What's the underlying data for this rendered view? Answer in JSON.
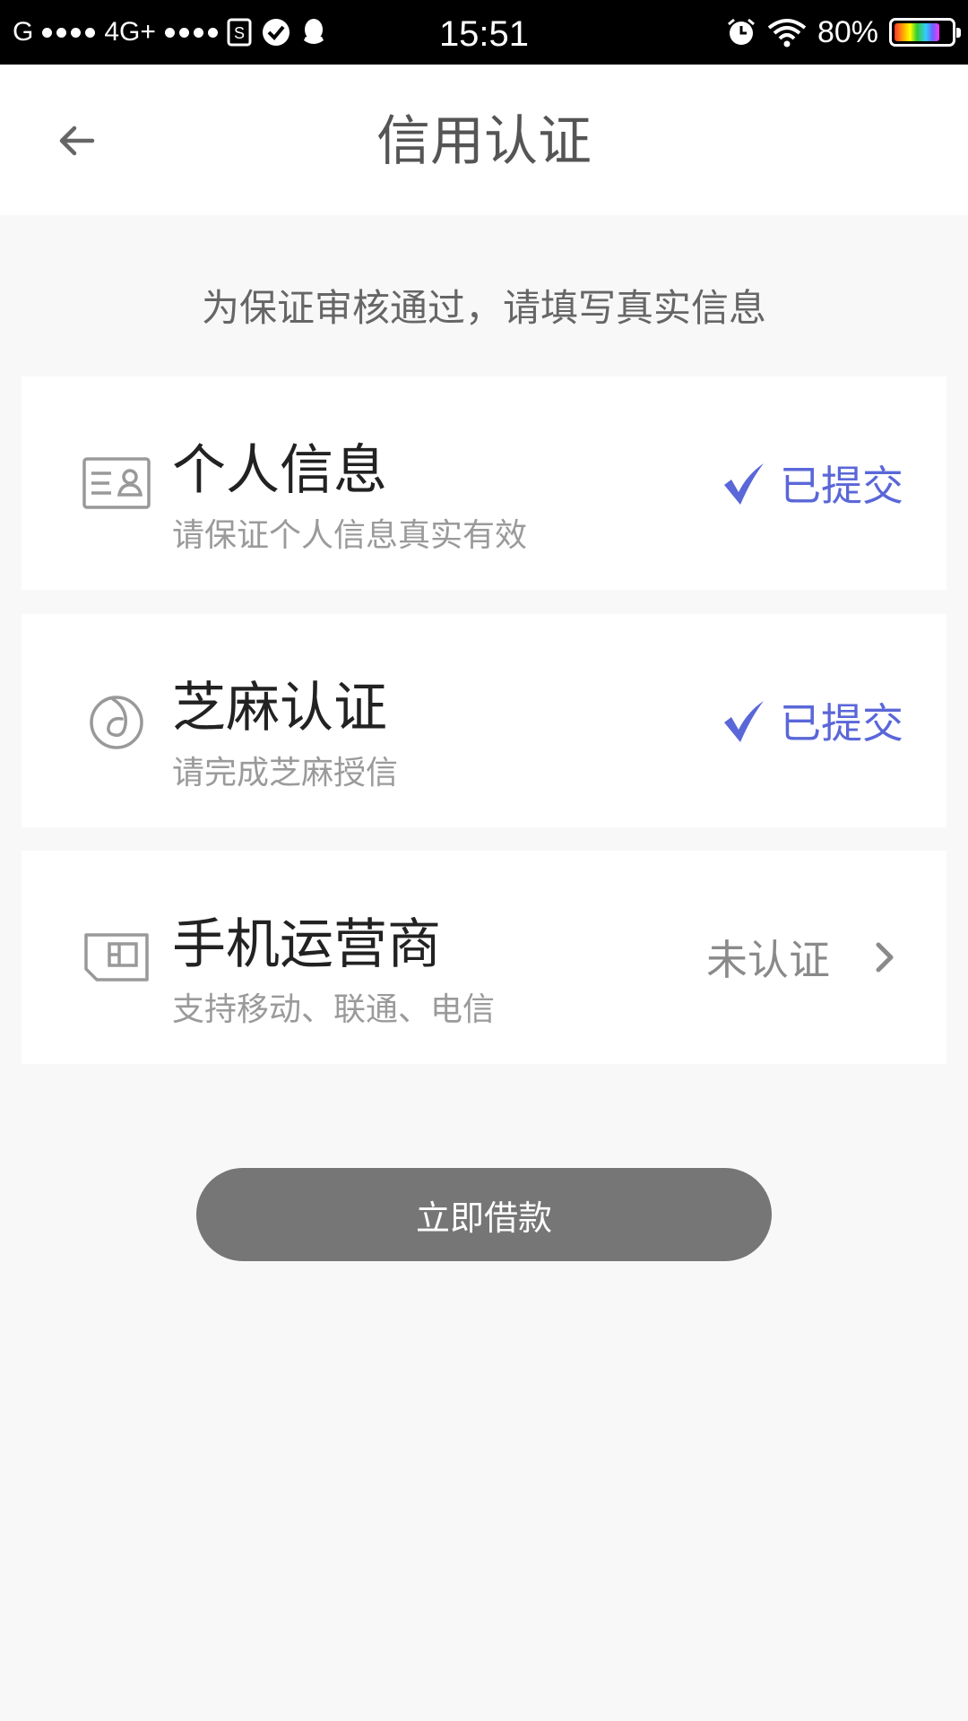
{
  "status_bar": {
    "carrier1": "G",
    "network": "4G+",
    "time": "15:51",
    "battery_percent": "80%",
    "battery_level": 0.8,
    "icons": [
      "sim-icon",
      "check-circle-icon",
      "qq-icon",
      "alarm-icon",
      "wifi-icon",
      "battery-icon"
    ]
  },
  "header": {
    "title": "信用认证",
    "back_icon": "arrow-left-icon"
  },
  "notice": "为保证审核通过，请填写真实信息",
  "items": [
    {
      "title": "个人信息",
      "subtitle": "请保证个人信息真实有效",
      "status": "已提交",
      "icon": "id-card-icon",
      "done": true
    },
    {
      "title": "芝麻认证",
      "subtitle": "请完成芝麻授信",
      "status": "已提交",
      "icon": "sesame-icon",
      "done": true
    },
    {
      "title": "手机运营商",
      "subtitle": "支持移动、联通、电信",
      "status": "未认证",
      "icon": "sim-card-icon",
      "done": false
    }
  ],
  "colors": {
    "accent": "#5a67d8",
    "button_bg": "#767676",
    "page_bg": "#f8f8f8"
  },
  "loan_button": "立即借款"
}
